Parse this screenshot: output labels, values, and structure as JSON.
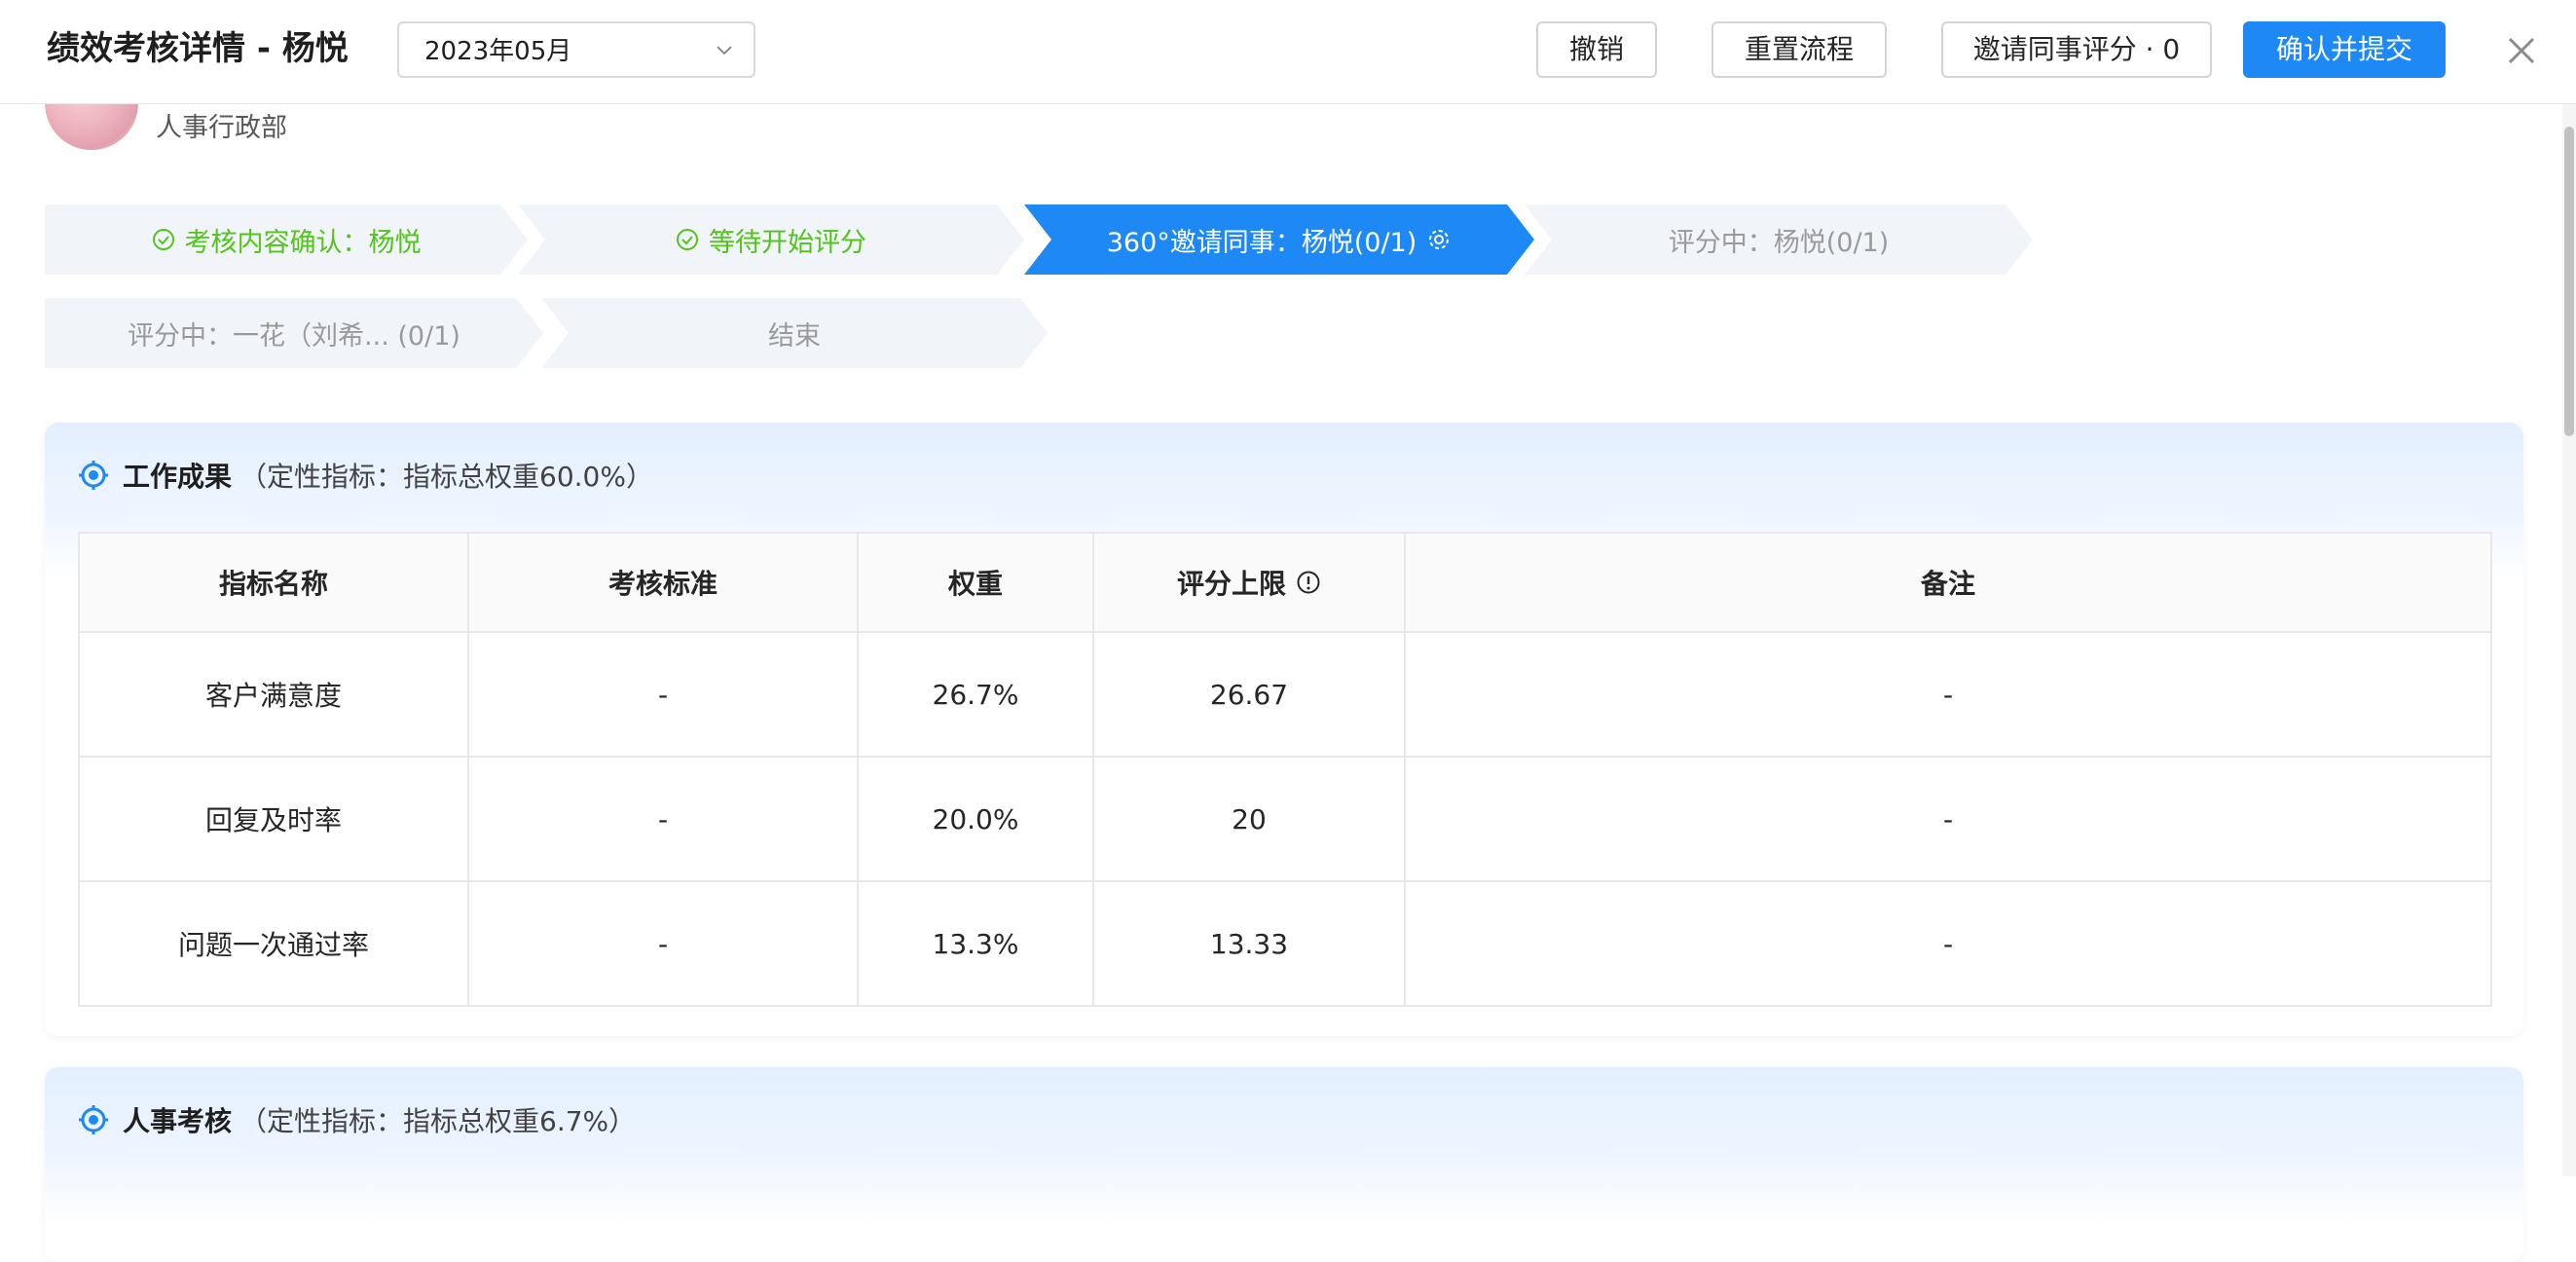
{
  "header": {
    "title": "绩效考核详情 - 杨悦",
    "month_value": "2023年05月",
    "buttons": {
      "revoke": "撤销",
      "reset": "重置流程",
      "invite": "邀请同事评分 · 0",
      "confirm": "确认并提交"
    }
  },
  "profile": {
    "department": "人事行政部"
  },
  "steps": [
    {
      "label": "考核内容确认：杨悦",
      "state": "done"
    },
    {
      "label": "等待开始评分",
      "state": "done"
    },
    {
      "label": "360°邀请同事：杨悦(0/1)",
      "state": "active"
    },
    {
      "label": "评分中：杨悦(0/1)",
      "state": "pending"
    },
    {
      "label": "评分中：一花（刘希... (0/1)",
      "state": "pending"
    },
    {
      "label": "结束",
      "state": "pending"
    }
  ],
  "sections": [
    {
      "title": "工作成果",
      "subtitle": "（定性指标：指标总权重60.0%）",
      "columns": [
        "指标名称",
        "考核标准",
        "权重",
        "评分上限",
        "备注"
      ],
      "rows": [
        [
          "客户满意度",
          "-",
          "26.7%",
          "26.67",
          "-"
        ],
        [
          "回复及时率",
          "-",
          "20.0%",
          "20",
          "-"
        ],
        [
          "问题一次通过率",
          "-",
          "13.3%",
          "13.33",
          "-"
        ]
      ]
    },
    {
      "title": "人事考核",
      "subtitle": "（定性指标：指标总权重6.7%）"
    }
  ],
  "colors": {
    "primary": "#1e88f5",
    "done": "#52c41a",
    "pending_text": "#9a9a9a",
    "step_bg": "#f1f4f8"
  }
}
